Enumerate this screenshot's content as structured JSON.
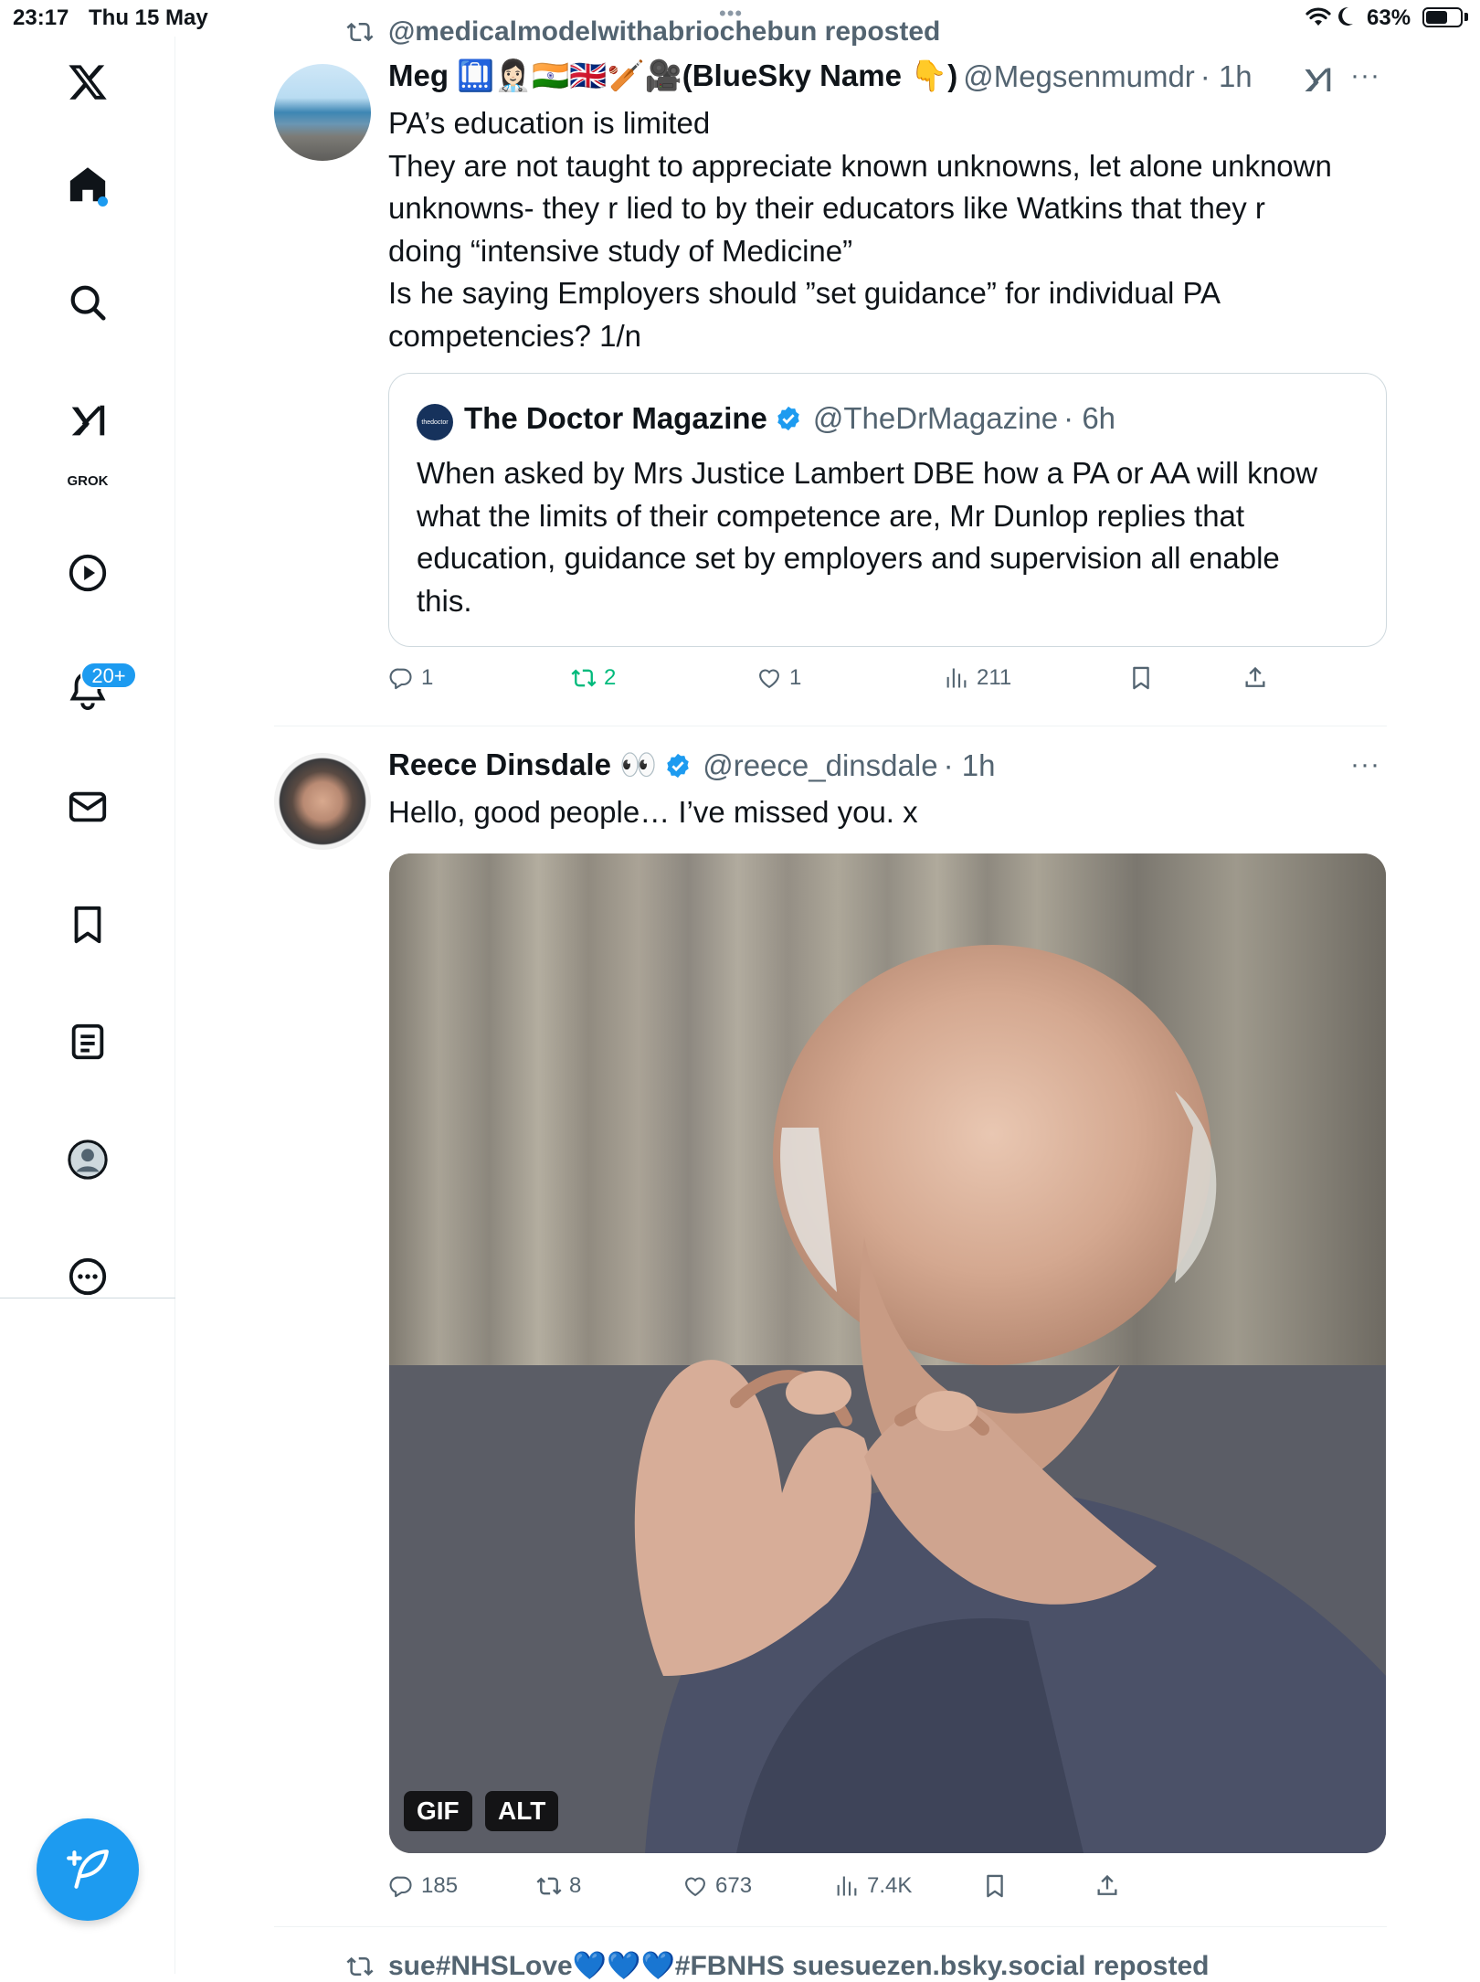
{
  "status_bar": {
    "time": "23:17",
    "date": "Thu 15 May",
    "battery_percent": "63%",
    "battery_level": 0.63,
    "multitask_dots": "•••"
  },
  "sidebar": {
    "items": [
      {
        "name": "x-logo",
        "icon": "x-logo-icon"
      },
      {
        "name": "home",
        "icon": "home-icon",
        "has_dot": true
      },
      {
        "name": "explore",
        "icon": "search-icon"
      },
      {
        "name": "grok",
        "icon": "grok-icon",
        "label": "GROK"
      },
      {
        "name": "videos",
        "icon": "play-icon"
      },
      {
        "name": "notifications",
        "icon": "bell-icon",
        "badge": "20+"
      },
      {
        "name": "messages",
        "icon": "mail-icon"
      },
      {
        "name": "bookmarks",
        "icon": "bookmark-icon"
      },
      {
        "name": "articles",
        "icon": "article-icon"
      },
      {
        "name": "profile",
        "icon": "profile-icon"
      },
      {
        "name": "more",
        "icon": "more-circle-icon"
      }
    ],
    "compose_icon": "compose-feather-icon"
  },
  "feed": {
    "post1": {
      "repost_context": "@medicalmodelwithabriochebun reposted",
      "author_name": "Meg 🛄👩🏻‍⚕️🇮🇳🇬🇧🏏🎥(BlueSky Name 👇)",
      "handle": "@Megsenmumdr",
      "time": "· 1h",
      "text_lines": [
        "PA’s education is limited",
        "They are not taught to appreciate known unknowns, let alone unknown",
        "unknowns- they r lied to by their educators like Watkins that they r",
        "doing “intensive study of Medicine”",
        "Is he saying Employers should ”set guidance” for individual PA",
        "competencies? 1/n"
      ],
      "quote": {
        "avatar_text": "thedoctor",
        "author_name": "The Doctor Magazine",
        "handle": "@TheDrMagazine",
        "time": "· 6h",
        "text_lines": [
          "When asked by Mrs Justice Lambert DBE how a PA or AA will know",
          "what the limits of their competence are, Mr Dunlop replies that",
          "education, guidance set by employers and supervision all enable",
          "this."
        ]
      },
      "actions": {
        "replies": "1",
        "reposts": "2",
        "likes": "1",
        "views": "211"
      },
      "more": "···"
    },
    "post2": {
      "author_name": "Reece Dinsdale 👀",
      "handle": "@reece_dinsdale",
      "time": "· 1h",
      "text": "Hello, good people… I’ve missed you. x",
      "media_badges": {
        "gif": "GIF",
        "alt": "ALT"
      },
      "actions": {
        "replies": "185",
        "reposts": "8",
        "likes": "673",
        "views": "7.4K"
      },
      "more": "···"
    },
    "post3": {
      "repost_context": "sue#NHSLove💙💙💙#FBNHS suesuezen.bsky.social reposted"
    }
  },
  "colors": {
    "accent": "#1d9bf0",
    "repost_green": "#00ba7c",
    "muted": "#536471",
    "text": "#0f1419"
  }
}
